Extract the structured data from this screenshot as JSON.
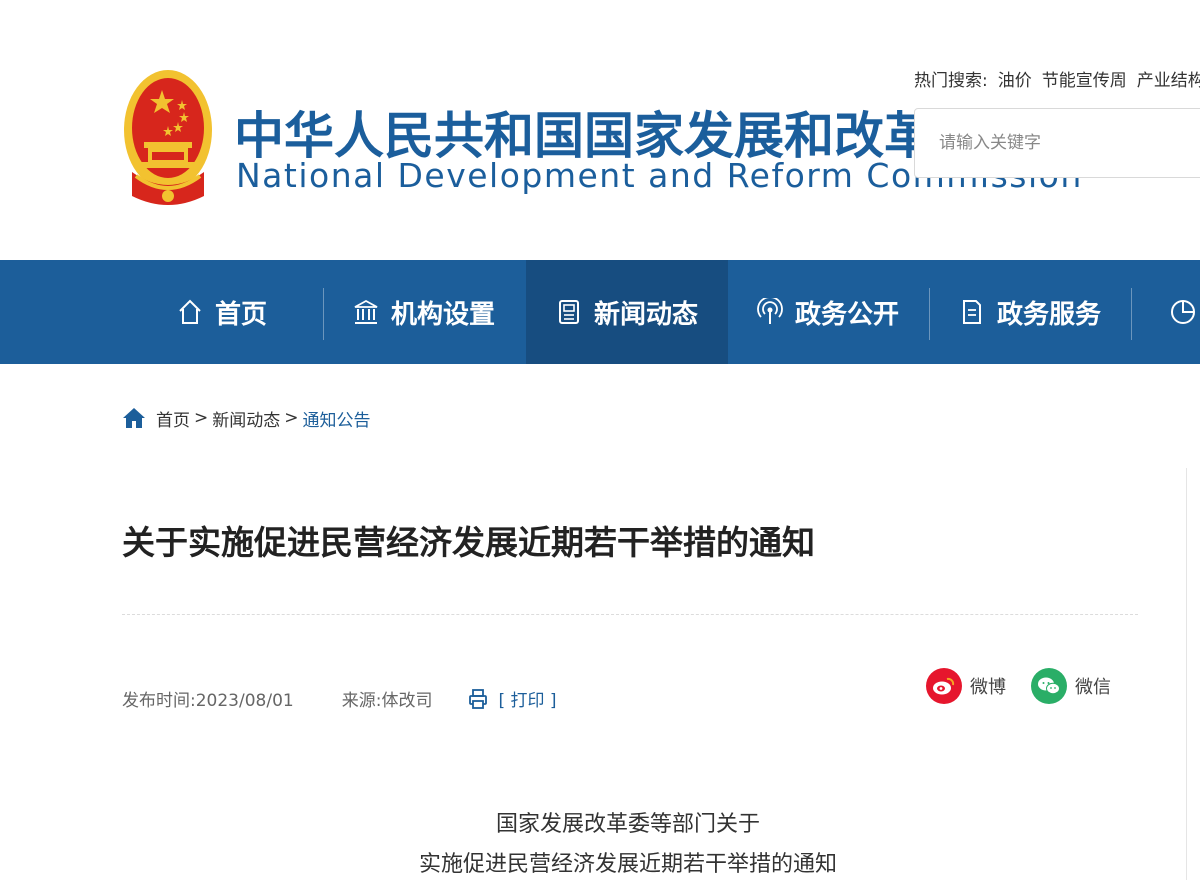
{
  "header": {
    "title_cn": "中华人民共和国国家发展和改革委员会",
    "title_en": "National Development and Reform Commission",
    "hot_search": {
      "label": "热门搜索:",
      "terms": [
        "油价",
        "节能宣传周",
        "产业结构调"
      ]
    },
    "search": {
      "placeholder": "请输入关键字"
    }
  },
  "nav": {
    "items": [
      {
        "label": "首页",
        "icon": "home-outline-icon"
      },
      {
        "label": "机构设置",
        "icon": "institution-building-icon"
      },
      {
        "label": "新闻动态",
        "icon": "newspaper-icon",
        "active": true
      },
      {
        "label": "政务公开",
        "icon": "broadcast-icon"
      },
      {
        "label": "政务服务",
        "icon": "document-icon"
      },
      {
        "label": "",
        "icon": "pie-chart-icon"
      }
    ]
  },
  "breadcrumb": {
    "items": [
      "首页",
      "新闻动态",
      "通知公告"
    ],
    "separator": ">"
  },
  "article": {
    "title": "关于实施促进民营经济发展近期若干举措的通知",
    "publish_time": "发布时间:2023/08/01",
    "source": "来源:体改司",
    "print_label": "[ 打印 ]",
    "share": {
      "weibo": "微博",
      "wechat": "微信"
    },
    "doc_heading_line1": "国家发展改革委等部门关于",
    "doc_heading_line2": "实施促进民营经济发展近期若干举措的通知"
  },
  "colors": {
    "brand_blue": "#1c5e9a",
    "nav_active": "#174d80",
    "weibo_red": "#e6162d",
    "wechat_green": "#2aae67",
    "emblem_red": "#d7261c",
    "emblem_gold": "#f2c230"
  }
}
